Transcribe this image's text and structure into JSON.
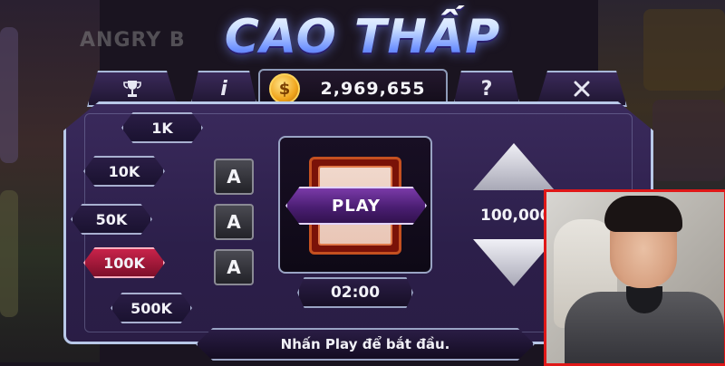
{
  "logo": {
    "text": "CAO THẤP"
  },
  "background": {
    "left_title": "ANGRY B"
  },
  "topbar": {
    "trophy_icon": "trophy-icon",
    "info_label": "i",
    "balance": "2,969,655",
    "coin_symbol": "$",
    "help_label": "?",
    "close_icon": "close-icon"
  },
  "bets": [
    {
      "label": "1K",
      "active": false
    },
    {
      "label": "10K",
      "active": false
    },
    {
      "label": "50K",
      "active": false
    },
    {
      "label": "100K",
      "active": true
    },
    {
      "label": "500K",
      "active": false
    }
  ],
  "aces": [
    "A",
    "A",
    "A"
  ],
  "play": {
    "label": "PLAY"
  },
  "timer": "02:00",
  "pot": "100,000",
  "status": "Nhấn Play để bắt đầu.",
  "colors": {
    "active_bet": "#c8234a",
    "panel": "#2c1f4a",
    "coin": "#f0a51d",
    "cam_border": "#e01818"
  }
}
